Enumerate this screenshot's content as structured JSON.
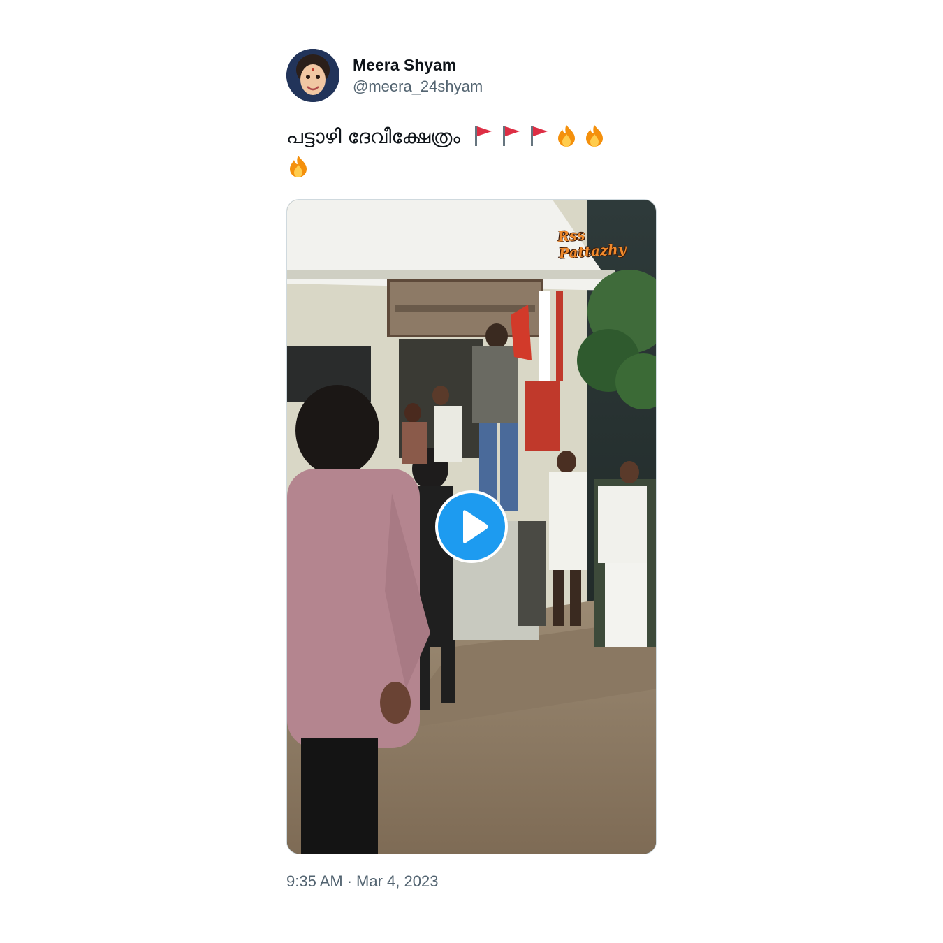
{
  "author": {
    "display_name": "Meera Shyam",
    "handle": "@meera_24shyam"
  },
  "tweet": {
    "text": "പട്ടാഴി ദേവീക്ഷേത്രം",
    "emojis": [
      "triangular-flag",
      "triangular-flag",
      "triangular-flag",
      "fire",
      "fire",
      "fire"
    ]
  },
  "media": {
    "type": "video",
    "watermark": "Rss Pattazhy",
    "play_icon": "play-icon"
  },
  "footer": {
    "time": "9:35 AM",
    "separator": "·",
    "date": "Mar 4, 2023"
  },
  "colors": {
    "accent": "#1d9bf0",
    "text_primary": "#0f1419",
    "text_secondary": "#536471",
    "border": "#cfd9de"
  }
}
